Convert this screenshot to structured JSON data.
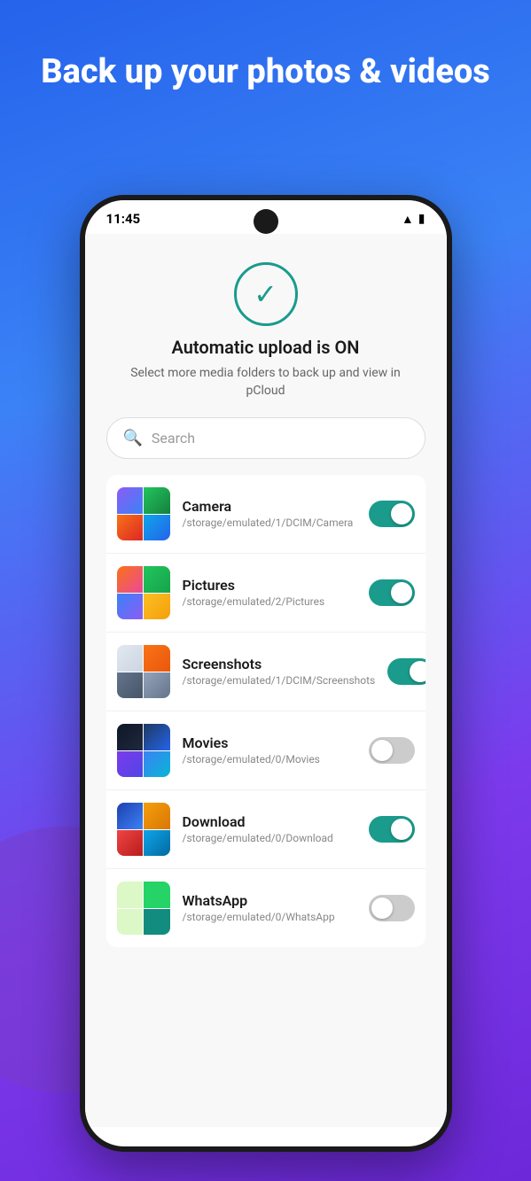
{
  "background": {
    "gradient_start": "#2563eb",
    "gradient_end": "#7c3aed"
  },
  "hero": {
    "title": "Back up your photos & videos"
  },
  "status_bar": {
    "time": "11:45",
    "wifi_icon": "wifi",
    "battery_icon": "battery"
  },
  "check_status": {
    "icon": "checkmark",
    "heading": "Automatic upload is ON",
    "subtitle": "Select more media folders to back up and view in pCloud"
  },
  "search": {
    "placeholder": "Search",
    "icon": "search"
  },
  "folders": [
    {
      "name": "Camera",
      "path": "/storage/emulated/1/DCIM/Camera",
      "enabled": true,
      "theme": "camera"
    },
    {
      "name": "Pictures",
      "path": "/storage/emulated/2/Pictures",
      "enabled": true,
      "theme": "pictures"
    },
    {
      "name": "Screenshots",
      "path": "/storage/emulated/1/DCIM/Screenshots",
      "enabled": true,
      "theme": "screenshots"
    },
    {
      "name": "Movies",
      "path": "/storage/emulated/0/Movies",
      "enabled": false,
      "theme": "movies"
    },
    {
      "name": "Download",
      "path": "/storage/emulated/0/Download",
      "enabled": true,
      "theme": "download"
    },
    {
      "name": "WhatsApp",
      "path": "/storage/emulated/0/WhatsApp",
      "enabled": false,
      "theme": "whatsapp"
    }
  ]
}
